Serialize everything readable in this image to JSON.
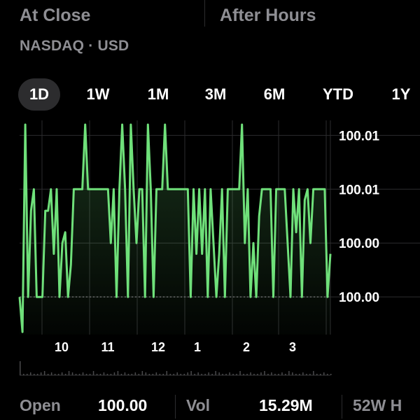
{
  "header": {
    "at_close": "At Close",
    "after_hours": "After Hours",
    "exchange": "NASDAQ · USD"
  },
  "tabs": [
    {
      "label": "1D",
      "selected": true
    },
    {
      "label": "1W",
      "selected": false
    },
    {
      "label": "1M",
      "selected": false
    },
    {
      "label": "3M",
      "selected": false
    },
    {
      "label": "6M",
      "selected": false
    },
    {
      "label": "YTD",
      "selected": false
    },
    {
      "label": "1Y",
      "selected": false
    }
  ],
  "colors": {
    "line": "#6fe07a",
    "grid": "#2c2c2e",
    "baseline": "#8e8e93"
  },
  "chart_data": {
    "type": "line",
    "y_tick_labels": [
      "100.01",
      "100.01",
      "100.00",
      "100.00"
    ],
    "y_tick_levels": [
      4,
      3,
      2,
      1
    ],
    "x_tick_labels": [
      "10",
      "11",
      "12",
      "1",
      "2",
      "3"
    ],
    "baseline_level": 1,
    "ylim": [
      0.3,
      4.2
    ],
    "series": [
      {
        "values": [
          1,
          0.35,
          4.2,
          1,
          2.6,
          3,
          1,
          1,
          1,
          2.6,
          2.6,
          3,
          1.8,
          3,
          1,
          2,
          2.2,
          1,
          1.6,
          3,
          3,
          3,
          3,
          4.2,
          3,
          3,
          3,
          3,
          3,
          3,
          3,
          3,
          2,
          3,
          1,
          3,
          4.2,
          3,
          1,
          4.2,
          3,
          2,
          3,
          3,
          1,
          4.2,
          3,
          1,
          3,
          3,
          3,
          4.2,
          3,
          3,
          3,
          3,
          3,
          3,
          3,
          3,
          1,
          3,
          1.8,
          3,
          1.8,
          3,
          1,
          3,
          2,
          1,
          1.8,
          3,
          1,
          3,
          3,
          3,
          3,
          3,
          4.2,
          2,
          3,
          1,
          2,
          1,
          2.5,
          3,
          3,
          3,
          3,
          1,
          3,
          3,
          3,
          3,
          2,
          1,
          3,
          2.2,
          3,
          1,
          2.8,
          3,
          2,
          3,
          3,
          3,
          3,
          3,
          1,
          1.8
        ]
      }
    ]
  },
  "stats": {
    "open_label": "Open",
    "open_value": "100.00",
    "vol_label": "Vol",
    "vol_value": "15.29M",
    "w52_label": "52W H"
  }
}
